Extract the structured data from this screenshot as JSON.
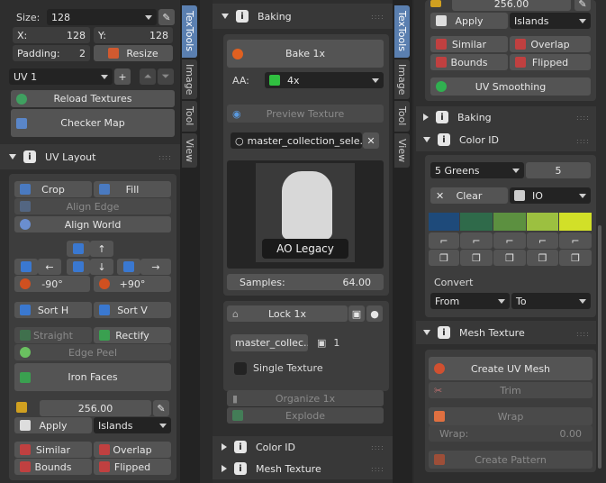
{
  "left": {
    "size_label": "Size:",
    "size_value": "128",
    "x_label": "X:",
    "x_value": "128",
    "y_label": "Y:",
    "y_value": "128",
    "padding_label": "Padding:",
    "padding_value": "2",
    "resize": "Resize",
    "uv_channel": "UV 1",
    "plus": "+",
    "reload": "Reload Textures",
    "checker": "Checker Map",
    "uv_layout_title": "UV Layout",
    "crop": "Crop",
    "fill": "Fill",
    "align_edge": "Align Edge",
    "align_world": "Align World",
    "arrow_up": "↑",
    "arrow_left": "←",
    "arrow_down": "↓",
    "arrow_right": "→",
    "rot_neg": "-90°",
    "rot_pos": "+90°",
    "sort_h": "Sort H",
    "sort_v": "Sort V",
    "straight": "Straight",
    "rectify": "Rectify",
    "edge_peel": "Edge Peel",
    "iron_faces": "Iron Faces",
    "scale_value": "256.00",
    "apply": "Apply",
    "islands": "Islands",
    "similar": "Similar",
    "overlap": "Overlap",
    "bounds": "Bounds",
    "flipped": "Flipped"
  },
  "tabs_left": [
    "TexTools",
    "Image",
    "Tool",
    "View"
  ],
  "middle": {
    "baking_title": "Baking",
    "bake": "Bake 1x",
    "aa_label": "AA:",
    "aa_value": "4x",
    "preview": "Preview Texture",
    "collection": "master_collection_sele...",
    "thumb_label": "AO Legacy",
    "samples_label": "Samples:",
    "samples_value": "64.00",
    "lock": "Lock 1x",
    "collection2": "master_collec...",
    "count": "1",
    "single_texture": "Single Texture",
    "organize": "Organize 1x",
    "explode": "Explode",
    "color_id_title": "Color ID",
    "mesh_texture_title": "Mesh Texture"
  },
  "tabs_mid": [
    "TexTools",
    "Image",
    "Tool",
    "View"
  ],
  "right": {
    "scale_value": "256.00",
    "apply": "Apply",
    "islands": "Islands",
    "similar": "Similar",
    "overlap": "Overlap",
    "bounds": "Bounds",
    "flipped": "Flipped",
    "uv_smoothing": "UV Smoothing",
    "baking_title": "Baking",
    "color_id_title": "Color ID",
    "palette": "5 Greens",
    "palette_count": "5",
    "clear": "Clear",
    "io": "IO",
    "swatches": [
      "#1e4a7a",
      "#2f6a4a",
      "#5c9040",
      "#9cc040",
      "#d2e028"
    ],
    "convert_label": "Convert",
    "from": "From",
    "to": "To",
    "mesh_texture_title": "Mesh Texture",
    "create_uv_mesh": "Create UV Mesh",
    "trim": "Trim",
    "wrap": "Wrap",
    "wrap_label": "Wrap:",
    "wrap_value": "0.00",
    "create_pattern": "Create Pattern"
  }
}
